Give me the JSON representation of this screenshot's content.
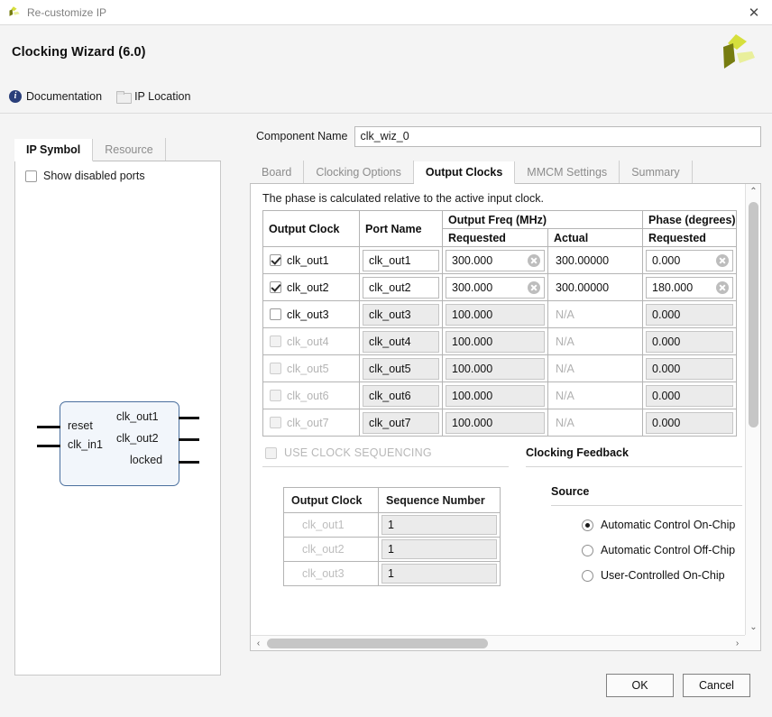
{
  "window": {
    "title": "Re-customize IP",
    "close_label": "✕",
    "app_icon": "xilinx-logo-icon"
  },
  "header": {
    "title": "Clocking Wizard (6.0)",
    "logo_icon": "xilinx-logo-icon"
  },
  "links": [
    {
      "label": "Documentation",
      "icon": "info-icon"
    },
    {
      "label": "IP Location",
      "icon": "folder-icon"
    }
  ],
  "left_panel": {
    "tabs": [
      {
        "label": "IP Symbol",
        "active": true
      },
      {
        "label": "Resource",
        "active": false
      }
    ],
    "show_disabled_ports": {
      "label": "Show disabled ports",
      "checked": false
    },
    "symbol": {
      "inputs": [
        "reset",
        "clk_in1"
      ],
      "outputs": [
        "clk_out1",
        "clk_out2",
        "locked"
      ]
    }
  },
  "component_name": {
    "label": "Component Name",
    "value": "clk_wiz_0",
    "placeholder": "clk_wiz_0"
  },
  "main_tabs": [
    {
      "label": "Board",
      "active": false
    },
    {
      "label": "Clocking Options",
      "active": false
    },
    {
      "label": "Output Clocks",
      "active": true
    },
    {
      "label": "MMCM Settings",
      "active": false
    },
    {
      "label": "Summary",
      "active": false
    }
  ],
  "output_clocks": {
    "hint": "The phase is calculated relative to the active input clock.",
    "headers": {
      "output_clock": "Output Clock",
      "port_name": "Port Name",
      "output_freq_group": "Output Freq (MHz)",
      "freq_requested": "Requested",
      "freq_actual": "Actual",
      "phase_group": "Phase (degrees)",
      "phase_requested": "Requested"
    },
    "rows": [
      {
        "name": "clk_out1",
        "checked": true,
        "enabled": true,
        "port": "clk_out1",
        "req": "300.000",
        "actual": "300.00000",
        "phase": "0.000",
        "clearable": true
      },
      {
        "name": "clk_out2",
        "checked": true,
        "enabled": true,
        "port": "clk_out2",
        "req": "300.000",
        "actual": "300.00000",
        "phase": "180.000",
        "clearable": true
      },
      {
        "name": "clk_out3",
        "checked": false,
        "enabled": true,
        "port": "clk_out3",
        "req": "100.000",
        "actual": "N/A",
        "phase": "0.000",
        "clearable": false
      },
      {
        "name": "clk_out4",
        "checked": false,
        "enabled": false,
        "port": "clk_out4",
        "req": "100.000",
        "actual": "N/A",
        "phase": "0.000",
        "clearable": false
      },
      {
        "name": "clk_out5",
        "checked": false,
        "enabled": false,
        "port": "clk_out5",
        "req": "100.000",
        "actual": "N/A",
        "phase": "0.000",
        "clearable": false
      },
      {
        "name": "clk_out6",
        "checked": false,
        "enabled": false,
        "port": "clk_out6",
        "req": "100.000",
        "actual": "N/A",
        "phase": "0.000",
        "clearable": false
      },
      {
        "name": "clk_out7",
        "checked": false,
        "enabled": false,
        "port": "clk_out7",
        "req": "100.000",
        "actual": "N/A",
        "phase": "0.000",
        "clearable": false
      }
    ]
  },
  "clock_sequencing": {
    "toggle_label": "USE CLOCK SEQUENCING",
    "toggle_checked": false,
    "headers": {
      "output_clock": "Output Clock",
      "sequence_number": "Sequence Number"
    },
    "rows": [
      {
        "name": "clk_out1",
        "seq": "1"
      },
      {
        "name": "clk_out2",
        "seq": "1"
      },
      {
        "name": "clk_out3",
        "seq": "1"
      }
    ]
  },
  "clocking_feedback": {
    "title": "Clocking Feedback",
    "source_title": "Source",
    "options": [
      {
        "label": "Automatic Control On-Chip",
        "selected": true
      },
      {
        "label": "Automatic Control Off-Chip",
        "selected": false
      },
      {
        "label": "User-Controlled On-Chip",
        "selected": false
      }
    ]
  },
  "scrollbars": {
    "v_up": "⌃",
    "v_down": "⌄",
    "h_left": "‹",
    "h_right": "›"
  },
  "buttons": {
    "ok": "OK",
    "cancel": "Cancel"
  },
  "colors": {
    "accent_blue": "#2a3f7a",
    "symbol_border": "#4a6f9e",
    "symbol_fill": "#f2f6fb",
    "logo_dark": "#767c10",
    "logo_bright": "#d6df3c",
    "logo_pale": "#e9ef9b",
    "panel_bg": "#f4f4f4",
    "disabled_text": "#b4b4b4"
  }
}
